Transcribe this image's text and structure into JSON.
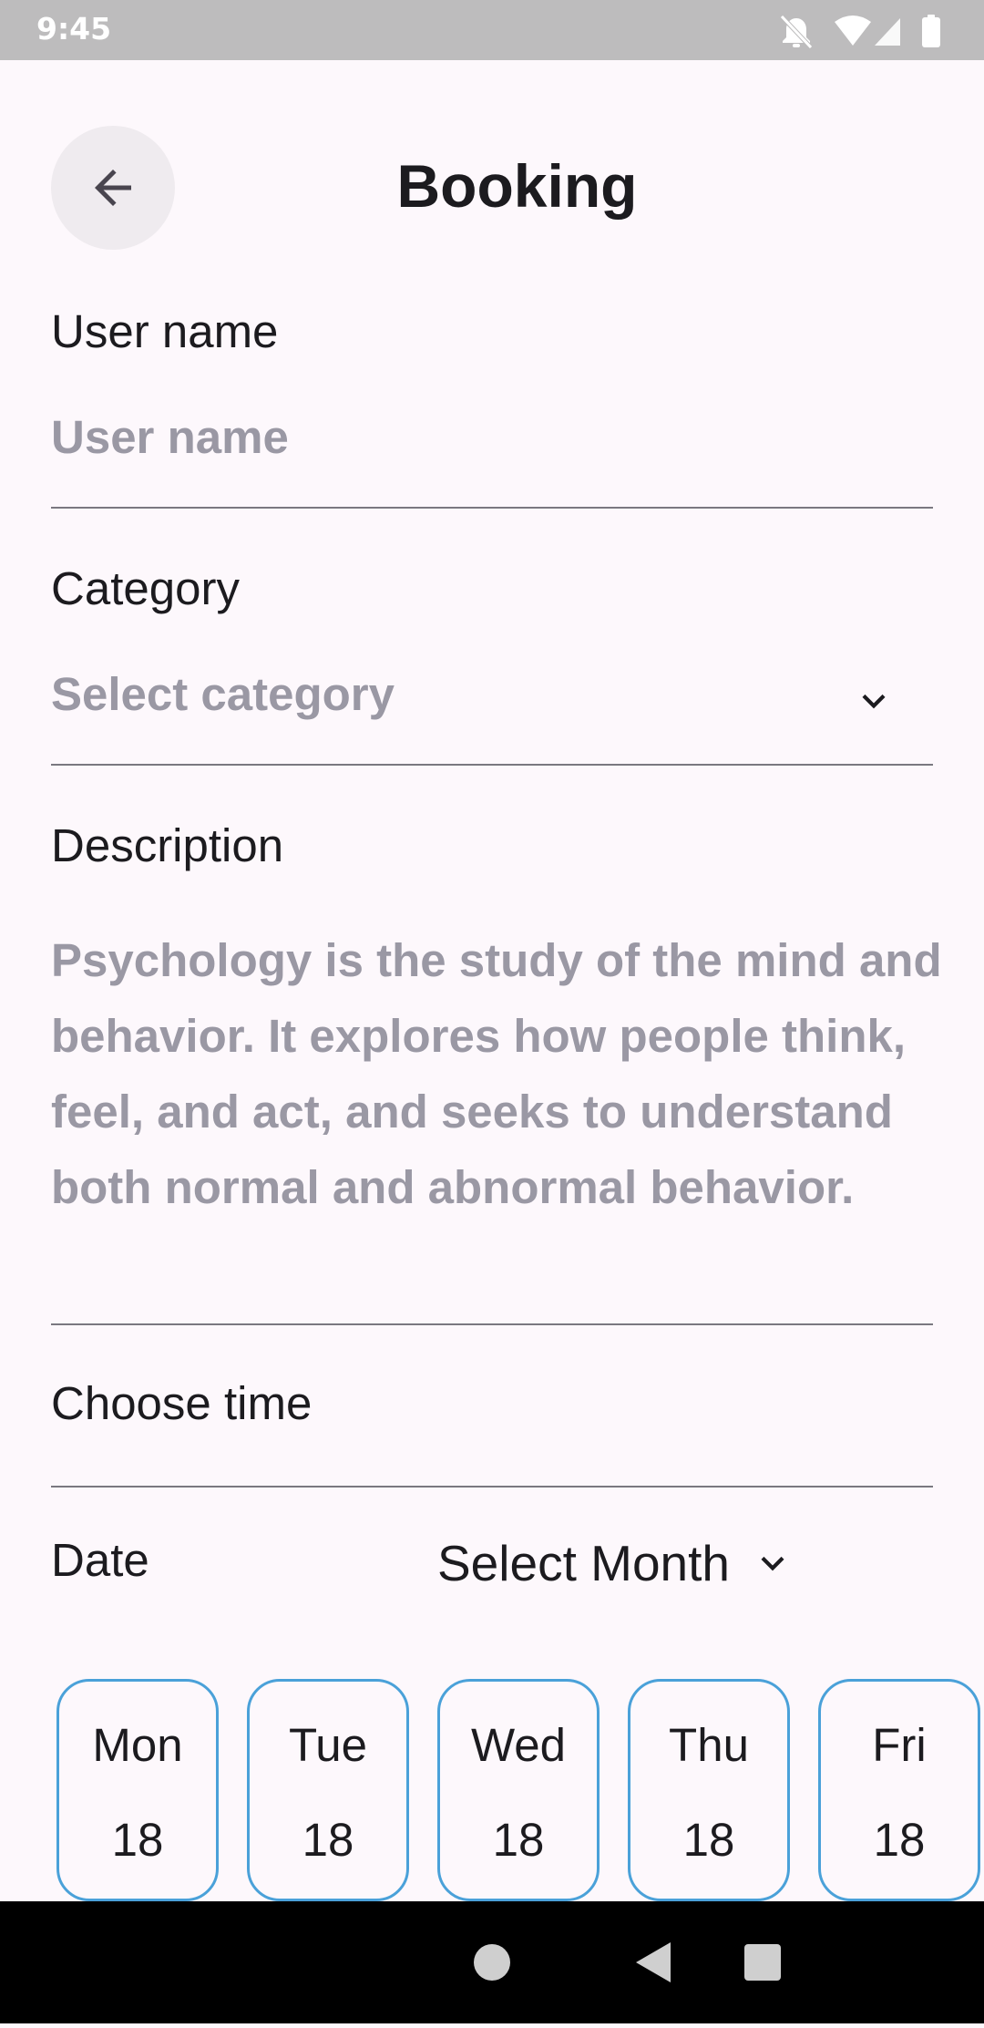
{
  "status_bar": {
    "time": "9:45",
    "icons": [
      "bell-off-icon",
      "wifi-icon",
      "signal-icon",
      "battery-icon"
    ]
  },
  "header": {
    "title": "Booking",
    "back_icon": "arrow-left-icon"
  },
  "form": {
    "user_name": {
      "label": "User name",
      "placeholder": "User name"
    },
    "category": {
      "label": "Category",
      "placeholder": "Select category",
      "icon": "chevron-down-icon"
    },
    "description": {
      "label": "Description",
      "placeholder": "Psychology is the study of the mind and behavior. It explores how people think, feel, and act, and seeks to understand both normal and abnormal behavior."
    },
    "time": {
      "label": "Choose time"
    },
    "date": {
      "label": "Date",
      "month_select": "Select Month",
      "days": [
        {
          "name": "Mon",
          "num": "18"
        },
        {
          "name": "Tue",
          "num": "18"
        },
        {
          "name": "Wed",
          "num": "18"
        },
        {
          "name": "Thu",
          "num": "18"
        },
        {
          "name": "Fri",
          "num": "18"
        }
      ]
    }
  },
  "colors": {
    "background": "#fdf8fc",
    "accent_border": "#4aa1d9",
    "placeholder": "#9a98a4",
    "status_bar": "#bdbcbd",
    "nav_bar": "#000000"
  },
  "nav_bar": {
    "icons": [
      "back-triangle-icon",
      "home-circle-icon",
      "recents-square-icon"
    ]
  }
}
